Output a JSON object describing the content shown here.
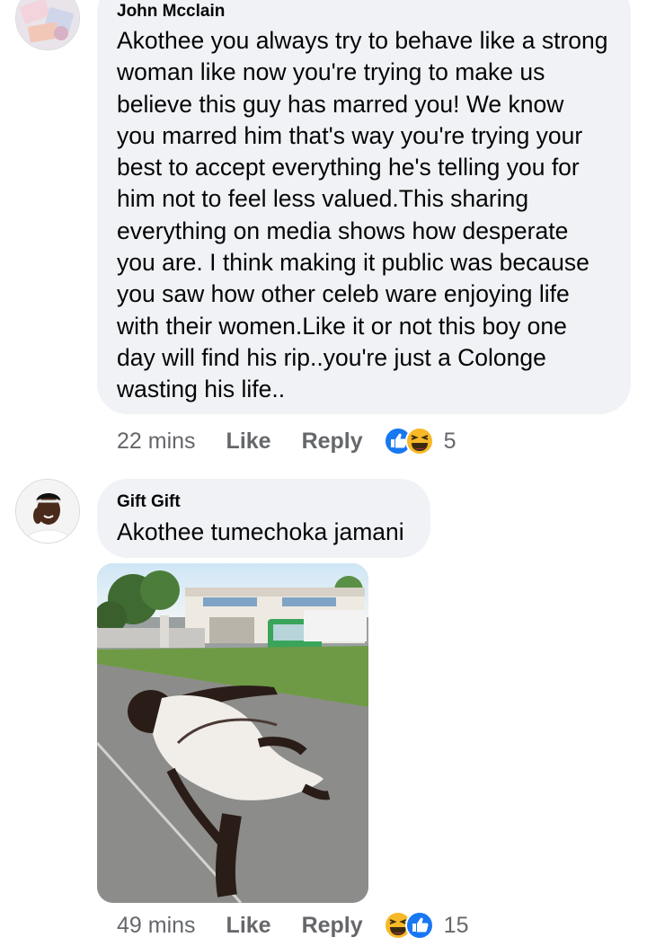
{
  "comments": [
    {
      "author": "John Mcclain",
      "text": "Akothee you always try to behave like a strong\nwoman like now you're trying to make us\nbelieve  this guy has marred you! We know\nyou marred him that's way you're trying your\nbest to accept everything he's telling you for\nhim not to feel  less valued.This sharing\neverything on media shows how desperate\nyou are. I think making it public was because\nyou saw how other  celeb ware enjoying life\nwith their women.Like it or not this boy one\nday will find his rip..you're just a Colonge\nwasting his life..",
      "time": "22 mins",
      "like_label": "Like",
      "reply_label": "Reply",
      "reactions": [
        "like-icon",
        "laughing-icon"
      ],
      "reaction_count": "5"
    },
    {
      "author": "Gift Gift",
      "text": "Akothee tumechoka jamani",
      "time": "49 mins",
      "like_label": "Like",
      "reply_label": "Reply",
      "reactions": [
        "laughing-icon",
        "like-icon"
      ],
      "reaction_count": "15"
    }
  ],
  "colors": {
    "bubble": "#f0f2f5",
    "meta_text": "#65676b",
    "like_blue": "#1877f2",
    "haha_yellow": "#f7b928"
  }
}
